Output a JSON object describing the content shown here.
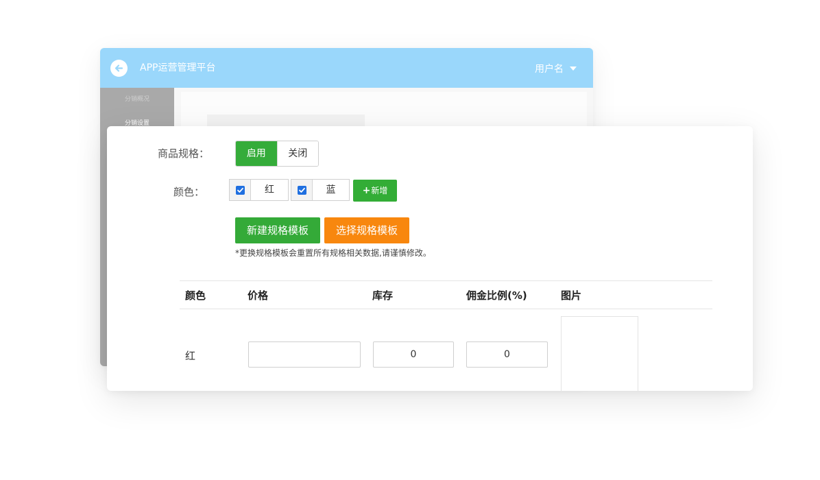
{
  "header": {
    "app_title": "APP运营管理平台",
    "username": "用户名"
  },
  "icons": {
    "back": "arrow-left-circle-icon",
    "caret": "caret-down-icon",
    "check": "checkmark-icon"
  },
  "colors": {
    "topbar": "#9ad7fb",
    "sidebar": "#a9a9a9",
    "primary_green": "#35ac3a",
    "accent_orange": "#f8870e",
    "checkbox_blue": "#1f6fe0"
  },
  "sidebar": {
    "items": [
      {
        "label": "分销概况"
      },
      {
        "label": "分销设置",
        "active": true
      }
    ]
  },
  "form": {
    "spec_label": "商品规格：",
    "spec_toggle": {
      "on_label": "启用",
      "off_label": "关闭",
      "selected": "启用"
    },
    "color_label": "颜色：",
    "colors": [
      {
        "name": "红",
        "checked": true
      },
      {
        "name": "蓝",
        "checked": true
      }
    ],
    "add_label": "新增",
    "new_template_label": "新建规格模板",
    "select_template_label": "选择规格模板",
    "warning": "*更换规格模板会重置所有规格相关数据,请谨慎修改。"
  },
  "table": {
    "headers": [
      "颜色",
      "价格",
      "库存",
      "佣金比例(%)",
      "图片"
    ],
    "rows": [
      {
        "color": "红",
        "price": "",
        "stock": "0",
        "commission": "0"
      }
    ]
  }
}
